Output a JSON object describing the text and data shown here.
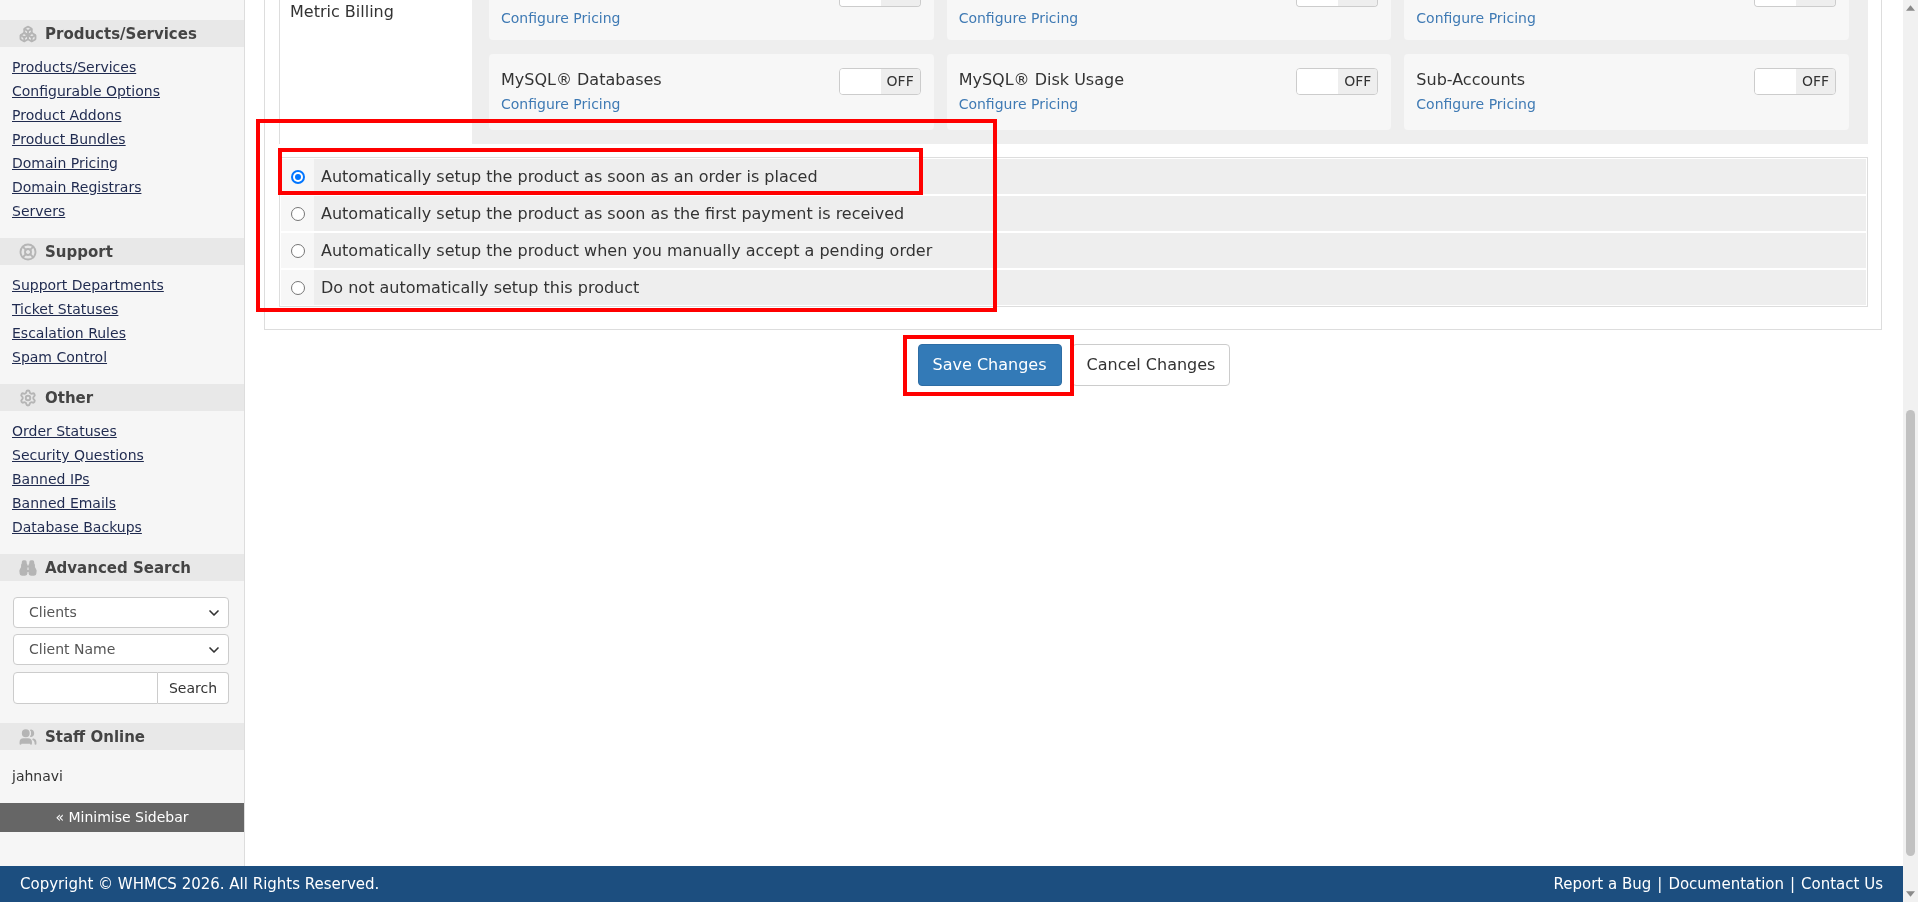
{
  "sidebar": {
    "sections": [
      {
        "kind": "links",
        "title": "Products/Services",
        "links": [
          "Products/Services",
          "Configurable Options",
          "Product Addons",
          "Product Bundles",
          "Domain Pricing",
          "Domain Registrars",
          "Servers"
        ]
      },
      {
        "kind": "links",
        "title": "Support",
        "links": [
          "Support Departments",
          "Ticket Statuses",
          "Escalation Rules",
          "Spam Control"
        ]
      },
      {
        "kind": "links",
        "title": "Other",
        "links": [
          "Order Statuses",
          "Security Questions",
          "Banned IPs",
          "Banned Emails",
          "Database Backups"
        ]
      },
      {
        "kind": "search",
        "title": "Advanced Search",
        "selects": [
          "Clients",
          "Client Name"
        ],
        "search_button": "Search"
      },
      {
        "kind": "staff",
        "title": "Staff Online",
        "users": [
          "jahnavi"
        ]
      }
    ],
    "minimise_button": "« Minimise Sidebar"
  },
  "metric_billing": {
    "label": "Metric Billing",
    "cards": [
      {
        "kind": "clipped",
        "toggle": {
          "on": false
        },
        "link": "Configure Pricing"
      },
      {
        "kind": "clipped",
        "toggle": {
          "on": false
        },
        "link": "Configure Pricing"
      },
      {
        "kind": "clipped",
        "toggle": {
          "on": false
        },
        "link": "Configure Pricing"
      },
      {
        "kind": "full",
        "name": "MySQL® Databases",
        "toggle": {
          "label": "OFF",
          "on": false
        },
        "link": "Configure Pricing"
      },
      {
        "kind": "full",
        "name": "MySQL® Disk Usage",
        "toggle": {
          "label": "OFF",
          "on": false
        },
        "link": "Configure Pricing"
      },
      {
        "kind": "full",
        "name": "Sub-Accounts",
        "toggle": {
          "label": "OFF",
          "on": false
        },
        "link": "Configure Pricing"
      }
    ]
  },
  "setup_options": {
    "highlighted": true,
    "options": [
      {
        "label": "Automatically setup the product as soon as an order is placed",
        "selected": true,
        "highlighted": true
      },
      {
        "label": "Automatically setup the product as soon as the first payment is received",
        "selected": false,
        "highlighted": false
      },
      {
        "label": "Automatically setup the product when you manually accept a pending order",
        "selected": false,
        "highlighted": false
      },
      {
        "label": "Do not automatically setup this product",
        "selected": false,
        "highlighted": false
      }
    ]
  },
  "buttons": [
    {
      "kind": "primary",
      "label": "Save Changes",
      "highlighted": true
    },
    {
      "kind": "default",
      "label": "Cancel Changes",
      "highlighted": false
    }
  ],
  "footer": {
    "copyright": "Copyright © WHMCS 2026. All Rights Reserved.",
    "links": [
      "Report a Bug",
      "Documentation",
      "Contact Us"
    ],
    "separators": [
      "|",
      "|"
    ]
  }
}
